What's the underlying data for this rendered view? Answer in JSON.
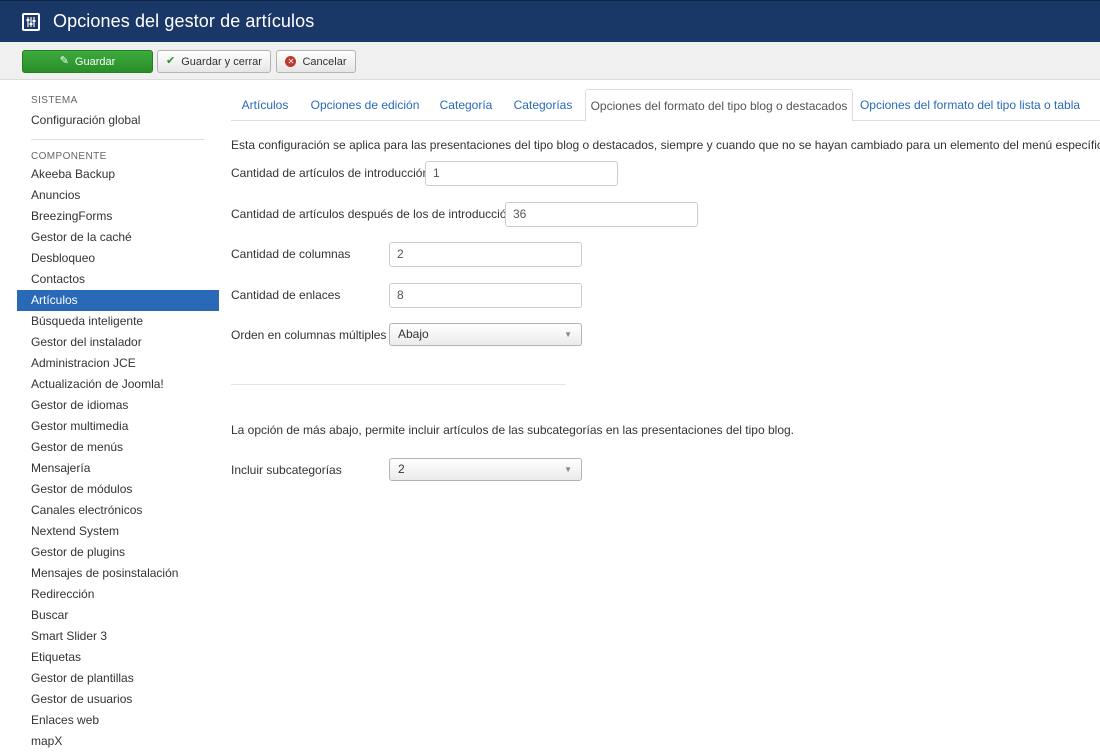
{
  "header": {
    "title": "Opciones del gestor de artículos",
    "icon": "sliders-icon"
  },
  "toolbar": {
    "save_label": "Guardar",
    "save_close_label": "Guardar y cerrar",
    "cancel_label": "Cancelar"
  },
  "sidebar": {
    "system_heading": "SISTEMA",
    "global_config": "Configuración global",
    "component_heading": "COMPONENTE",
    "items": [
      "Akeeba Backup",
      "Anuncios",
      "BreezingForms",
      "Gestor de la caché",
      "Desbloqueo",
      "Contactos",
      "Artículos",
      "Búsqueda inteligente",
      "Gestor del instalador",
      "Administracion JCE",
      "Actualización de Joomla!",
      "Gestor de idiomas",
      "Gestor multimedia",
      "Gestor de menús",
      "Mensajería",
      "Gestor de módulos",
      "Canales electrónicos",
      "Nextend System",
      "Gestor de plugins",
      "Mensajes de posinstalación",
      "Redirección",
      "Buscar",
      "Smart Slider 3",
      "Etiquetas",
      "Gestor de plantillas",
      "Gestor de usuarios",
      "Enlaces web",
      "mapX"
    ],
    "active_item": "Artículos"
  },
  "tabs": [
    "Artículos",
    "Opciones de edición",
    "Categoría",
    "Categorías",
    "Opciones del formato del tipo blog o destacados",
    "Opciones del formato del tipo lista o tabla"
  ],
  "active_tab": "Opciones del formato del tipo blog o destacados",
  "form": {
    "description": "Esta configuración se aplica para las presentaciones del tipo blog o destacados, siempre y cuando que no se hayan cambiado para un elemento del menú específico.",
    "intro_label": "Cantidad de artículos de introducción",
    "intro_value": "1",
    "after_intro_label": "Cantidad de artículos después de los de introducción",
    "after_intro_value": "36",
    "columns_label": "Cantidad de columnas",
    "columns_value": "2",
    "links_label": "Cantidad de enlaces",
    "links_value": "8",
    "order_label": "Orden en columnas múltiples",
    "order_value": "Abajo",
    "subcat_desc": "La opción de más abajo, permite incluir artículos de las subcategorías en las presentaciones del tipo blog.",
    "subcat_label": "Incluir subcategorías",
    "subcat_value": "2"
  },
  "colors": {
    "header_bg": "#1a3867",
    "save_green": "#2a8e2a",
    "active_blue": "#2a69b8",
    "link_blue": "#2a69b8"
  }
}
